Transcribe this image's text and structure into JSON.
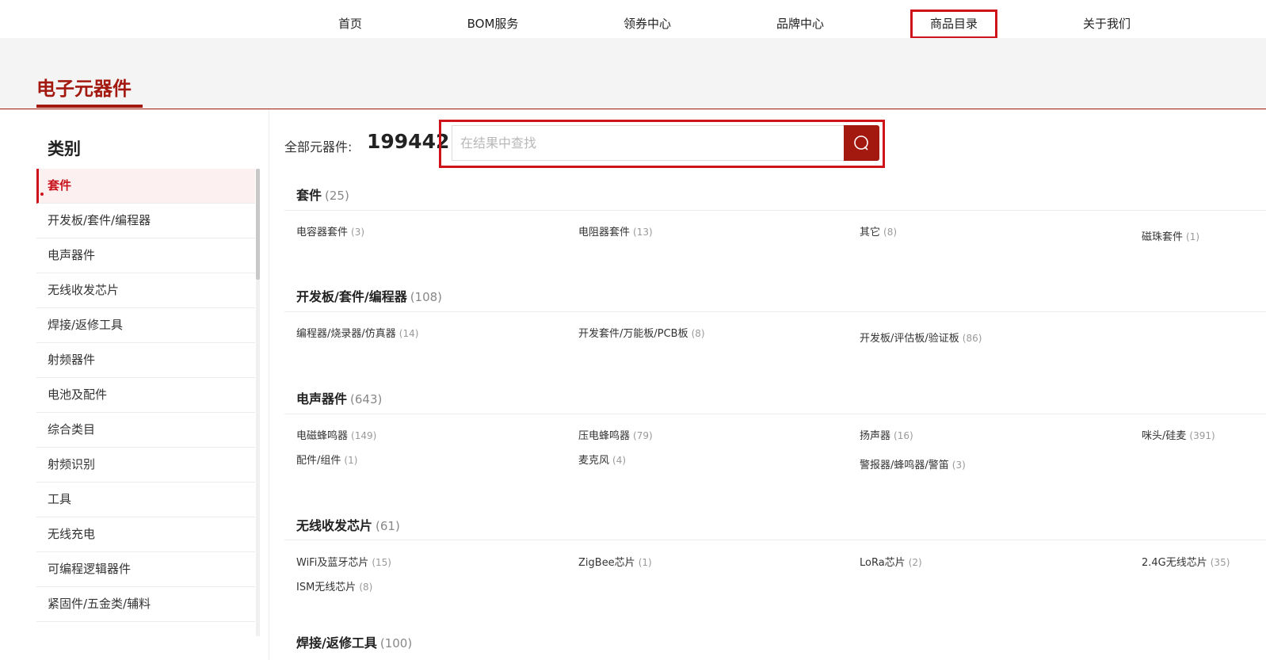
{
  "nav": {
    "items": [
      {
        "label": "首页"
      },
      {
        "label": "BOM服务"
      },
      {
        "label": "领券中心"
      },
      {
        "label": "品牌中心"
      },
      {
        "label": "商品目录"
      },
      {
        "label": "关于我们"
      }
    ],
    "active": "商品目录"
  },
  "page_title": "电子元器件",
  "sidebar": {
    "heading": "类别",
    "items": [
      {
        "label": "套件"
      },
      {
        "label": "开发板/套件/编程器"
      },
      {
        "label": "电声器件"
      },
      {
        "label": "无线收发芯片"
      },
      {
        "label": "焊接/返修工具"
      },
      {
        "label": "射频器件"
      },
      {
        "label": "电池及配件"
      },
      {
        "label": "综合类目"
      },
      {
        "label": "射频识别"
      },
      {
        "label": "工具"
      },
      {
        "label": "无线充电"
      },
      {
        "label": "可编程逻辑器件"
      },
      {
        "label": "紧固件/五金类/辅料"
      }
    ],
    "active": "套件"
  },
  "summary": {
    "label": "全部元器件:",
    "count": "199442"
  },
  "search": {
    "placeholder": "在结果中查找",
    "value": ""
  },
  "groups": [
    {
      "title": "套件",
      "count": "(25)",
      "items": [
        {
          "label": "电容器套件",
          "count": "(3)"
        },
        {
          "label": "电阻器套件",
          "count": "(13)"
        },
        {
          "label": "其它",
          "count": "(8)"
        },
        {
          "label": "磁珠套件",
          "count": "(1)"
        }
      ]
    },
    {
      "title": "开发板/套件/编程器",
      "count": "(108)",
      "items": [
        {
          "label": "编程器/烧录器/仿真器",
          "count": "(14)"
        },
        {
          "label": "开发套件/万能板/PCB板",
          "count": "(8)"
        },
        {
          "label": "开发板/评估板/验证板",
          "count": "(86)"
        }
      ]
    },
    {
      "title": "电声器件",
      "count": "(643)",
      "items": [
        {
          "label": "电磁蜂鸣器",
          "count": "(149)"
        },
        {
          "label": "压电蜂鸣器",
          "count": "(79)"
        },
        {
          "label": "扬声器",
          "count": "(16)"
        },
        {
          "label": "咪头/硅麦",
          "count": "(391)"
        },
        {
          "label": "配件/组件",
          "count": "(1)"
        },
        {
          "label": "麦克风",
          "count": "(4)"
        },
        {
          "label": "警报器/蜂鸣器/警笛",
          "count": "(3)"
        }
      ]
    },
    {
      "title": "无线收发芯片",
      "count": "(61)",
      "items": [
        {
          "label": "WiFi及蓝牙芯片",
          "count": "(15)"
        },
        {
          "label": "ZigBee芯片",
          "count": "(1)"
        },
        {
          "label": "LoRa芯片",
          "count": "(2)"
        },
        {
          "label": "2.4G无线芯片",
          "count": "(35)"
        },
        {
          "label": "ISM无线芯片",
          "count": "(8)"
        }
      ]
    },
    {
      "title": "焊接/返修工具",
      "count": "(100)",
      "items": []
    }
  ],
  "icons": {
    "search": "search-icon"
  },
  "colors": {
    "brand": "#a3180f",
    "highlight": "#d0121b"
  }
}
